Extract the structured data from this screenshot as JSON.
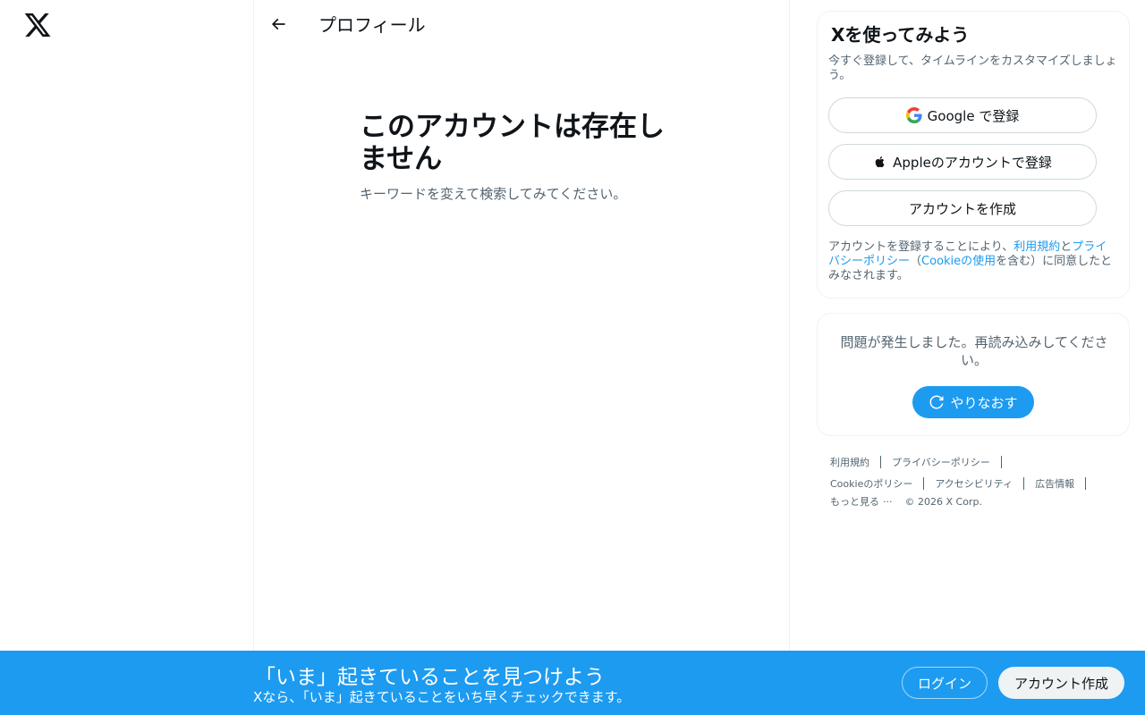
{
  "nav": {
    "logo_icon": "x-logo-icon"
  },
  "header": {
    "back_icon": "arrow-left-icon",
    "title": "プロフィール"
  },
  "main": {
    "empty_title": "このアカウントは存在しません",
    "empty_subtitle": "キーワードを変えて検索してみてください。"
  },
  "signup": {
    "title": "Xを使ってみよう",
    "subtitle": "今すぐ登録して、タイムラインをカスタマイズしましょう。",
    "google_label": "Google で登録",
    "apple_label": "Appleのアカウントで登録",
    "create_label": "アカウントを作成",
    "legal_prefix": "アカウントを登録することにより、",
    "legal_terms": "利用規約",
    "legal_and": "と",
    "legal_privacy": "プライバシーポリシー",
    "legal_open": "（",
    "legal_cookie": "Cookieの使用",
    "legal_suffix": "を含む）に同意したとみなされます。"
  },
  "error_card": {
    "message": "問題が発生しました。再読み込みしてください。",
    "retry_label": "やりなおす"
  },
  "footer": {
    "terms": "利用規約",
    "privacy": "プライバシーポリシー",
    "cookie": "Cookieのポリシー",
    "accessibility": "アクセシビリティ",
    "ads": "広告情報",
    "more": "もっと見る",
    "more_dots": "···",
    "copyright": "© 2026 X Corp."
  },
  "banner": {
    "title": "「いま」起きていることを見つけよう",
    "subtitle": "Xなら、「いま」起きていることをいち早くチェックできます。",
    "login_label": "ログイン",
    "create_label": "アカウント作成"
  },
  "colors": {
    "accent": "#1d9bf0",
    "text_primary": "#0f1419",
    "text_secondary": "#536471",
    "border": "#eff3f4"
  }
}
